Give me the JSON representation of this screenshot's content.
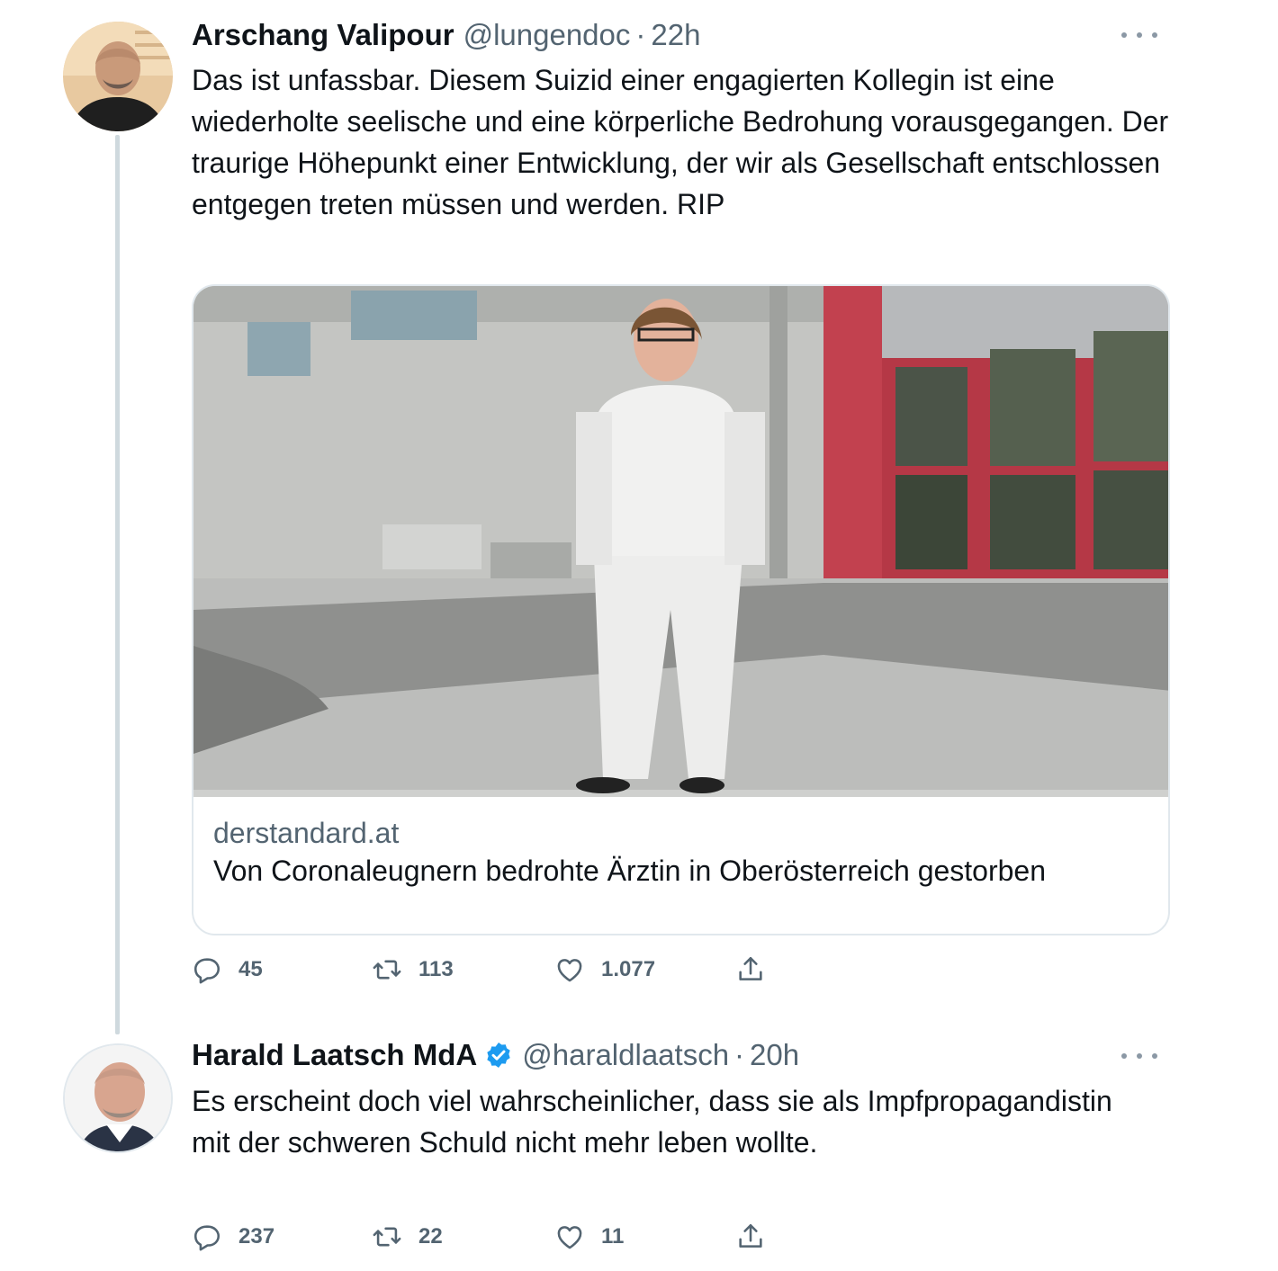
{
  "tweets": [
    {
      "name": "Arschang Valipour",
      "handle": "@lungendoc",
      "separator": "·",
      "time": "22h",
      "text": "Das ist unfassbar. Diesem Suizid einer engagierten Kollegin ist eine wiederholte seelische und eine körperliche Bedrohung vorausgegangen. Der traurige Höhepunkt einer Entwicklung, der wir als Gesellschaft entschlossen entgegen treten müssen und werden. RIP",
      "card": {
        "domain": "derstandard.at",
        "title": "Von Coronaleugnern bedrohte Ärztin in Oberösterreich gestorben"
      },
      "actions": {
        "replies": "45",
        "retweets": "113",
        "likes": "1.077"
      }
    },
    {
      "name": "Harald Laatsch MdA",
      "verified": true,
      "handle": "@haraldlaatsch",
      "separator": "·",
      "time": "20h",
      "text": "Es erscheint doch viel wahrscheinlicher, dass sie als Impfpropagandistin mit der schweren Schuld nicht mehr leben wollte.",
      "actions": {
        "replies": "237",
        "retweets": "22",
        "likes": "11"
      }
    }
  ],
  "colors": {
    "text": "#0f1419",
    "secondary": "#536471",
    "verified": "#1d9bf0",
    "thread_line": "#cfd9de"
  },
  "icons": [
    "reply-icon",
    "retweet-icon",
    "like-icon",
    "share-icon",
    "more-icon",
    "verified-badge-icon"
  ]
}
